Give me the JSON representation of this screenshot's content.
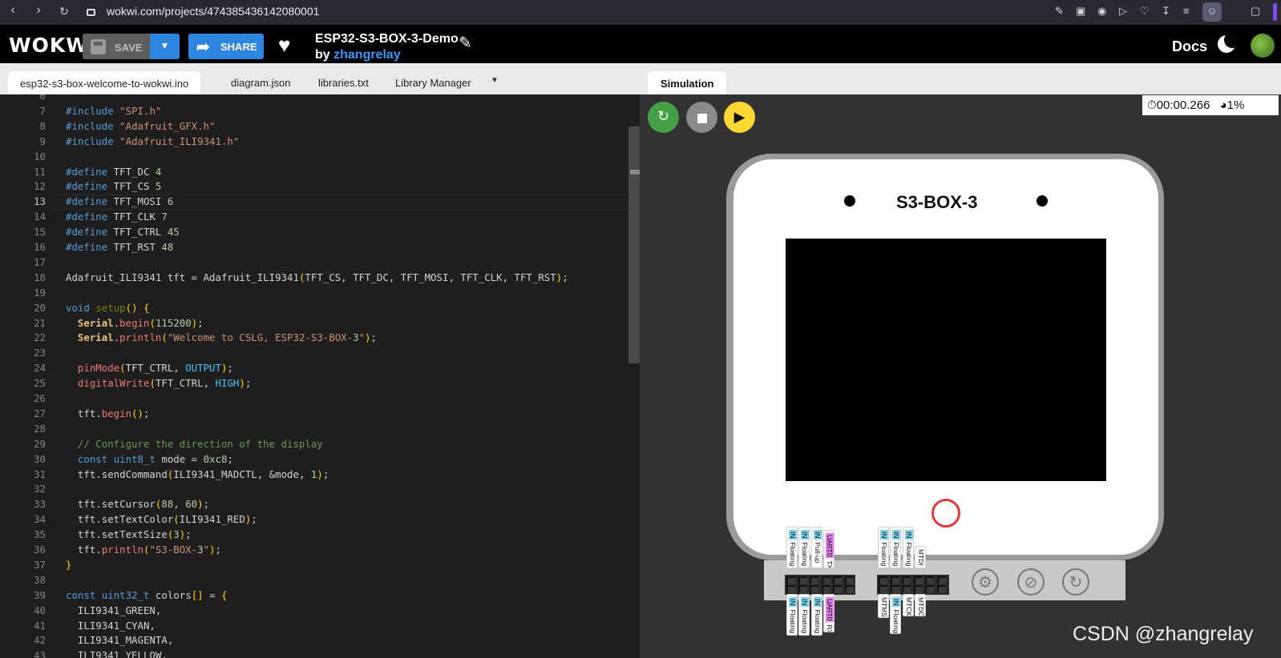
{
  "browser": {
    "url": "wokwi.com/projects/474385436142080001"
  },
  "header": {
    "logo": "WOKWi",
    "save_label": "SAVE",
    "share_label": "SHARE",
    "project_title": "ESP32-S3-BOX-3-Demo",
    "by_label": "by",
    "author": "zhangrelay",
    "docs_label": "Docs"
  },
  "editor": {
    "tabs": [
      {
        "label": "esp32-s3-box-welcome-to-wokwi.ino",
        "active": true
      },
      {
        "label": "diagram.json",
        "active": false
      },
      {
        "label": "libraries.txt",
        "active": false
      },
      {
        "label": "Library Manager",
        "active": false
      }
    ],
    "current_line": 13,
    "line_numbers": [
      "6",
      "7",
      "8",
      "9",
      "10",
      "11",
      "12",
      "13",
      "14",
      "15",
      "16",
      "17",
      "18",
      "19",
      "20",
      "21",
      "22",
      "23",
      "24",
      "25",
      "26",
      "27",
      "28",
      "29",
      "30",
      "31",
      "32",
      "33",
      "34",
      "35",
      "36",
      "37",
      "38",
      "39",
      "40",
      "41",
      "42",
      "43"
    ],
    "lines": [
      "",
      "#include \"SPI.h\"",
      "#include \"Adafruit_GFX.h\"",
      "#include \"Adafruit_ILI9341.h\"",
      "",
      "#define TFT_DC 4",
      "#define TFT_CS 5",
      "#define TFT_MOSI 6",
      "#define TFT_CLK 7",
      "#define TFT_CTRL 45",
      "#define TFT_RST 48",
      "",
      "Adafruit_ILI9341 tft = Adafruit_ILI9341(TFT_CS, TFT_DC, TFT_MOSI, TFT_CLK, TFT_RST);",
      "",
      "void setup() {",
      "  Serial.begin(115200);",
      "  Serial.println(\"Welcome to CSLG, ESP32-S3-BOX-3\");",
      "",
      "  pinMode(TFT_CTRL, OUTPUT);",
      "  digitalWrite(TFT_CTRL, HIGH);",
      "",
      "  tft.begin();",
      "",
      "  // Configure the direction of the display",
      "  const uint8_t mode = 0xc8;",
      "  tft.sendCommand(ILI9341_MADCTL, &mode, 1);",
      "",
      "  tft.setCursor(88, 60);",
      "  tft.setTextColor(ILI9341_RED);",
      "  tft.setTextSize(3);",
      "  tft.println(\"S3-BOX-3\");",
      "}",
      "",
      "const uint32_t colors[] = {",
      "  ILI9341_GREEN,",
      "  ILI9341_CYAN,",
      "  ILI9341_MAGENTA,",
      "  ILI9341_YELLOW,"
    ]
  },
  "simulation": {
    "tab_label": "Simulation",
    "elapsed": "00:00.266",
    "speed": "1%",
    "device_label": "S3-BOX-3",
    "pins_top_left": [
      {
        "dir": "IN",
        "mode": "Floating"
      },
      {
        "dir": "IN",
        "mode": "Floating"
      },
      {
        "dir": "IN",
        "mode": "Pull-up"
      },
      {
        "dir": "UART0",
        "mode": "TX"
      }
    ],
    "pins_bottom_left": [
      {
        "dir": "IN",
        "mode": "Floating"
      },
      {
        "dir": "IN",
        "mode": "Floating"
      },
      {
        "dir": "IN",
        "mode": "Floating"
      },
      {
        "dir": "UART0",
        "mode": "RX"
      }
    ],
    "pins_top_right": [
      {
        "dir": "IN",
        "mode": "Floating"
      },
      {
        "dir": "IN",
        "mode": "Floating"
      },
      {
        "dir": "IN",
        "mode": "Floating"
      },
      {
        "dir": "",
        "mode": "MTDI"
      }
    ],
    "pins_bottom_right": [
      {
        "dir": "",
        "mode": "MTMS"
      },
      {
        "dir": "IN",
        "mode": "Floating"
      },
      {
        "dir": "",
        "mode": "MTCK"
      },
      {
        "dir": "",
        "mode": "MTDO"
      }
    ]
  },
  "watermark": "CSDN @zhangrelay",
  "colors": {
    "share": "#2e86de",
    "restart": "#43a047",
    "stop": "#8a8a8a",
    "play": "#fdd835",
    "author_link": "#3d97ff"
  }
}
